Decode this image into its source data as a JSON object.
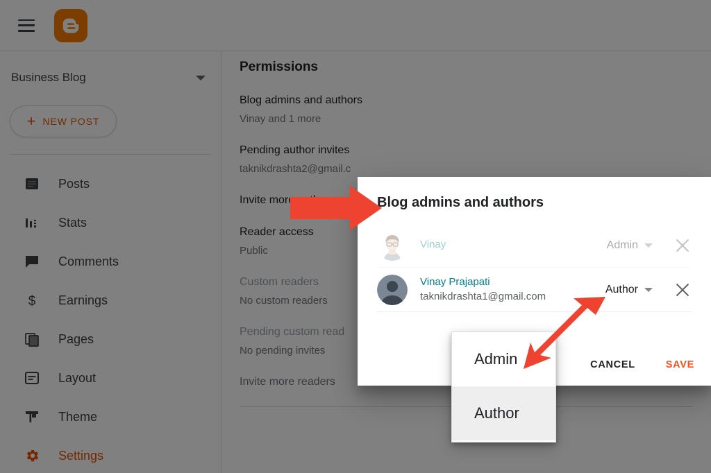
{
  "app": {
    "name": "Blogger",
    "accent_orange": "#e65100",
    "logo_bg": "#f57c00",
    "scrim_color": "#808080",
    "arrow_color": "#ef4331"
  },
  "topbar": {
    "menu_icon": "hamburger-menu-icon",
    "logo_icon": "blogger-logo-icon"
  },
  "sidebar": {
    "blog_name": "Business Blog",
    "blog_picker_icon": "chevron-down-icon",
    "new_post_label": "NEW POST",
    "new_post_icon": "plus-icon",
    "items": [
      {
        "label": "Posts",
        "icon": "posts-icon",
        "active": false
      },
      {
        "label": "Stats",
        "icon": "stats-icon",
        "active": false
      },
      {
        "label": "Comments",
        "icon": "comments-icon",
        "active": false
      },
      {
        "label": "Earnings",
        "icon": "earnings-icon",
        "active": false
      },
      {
        "label": "Pages",
        "icon": "pages-icon",
        "active": false
      },
      {
        "label": "Layout",
        "icon": "layout-icon",
        "active": false
      },
      {
        "label": "Theme",
        "icon": "theme-icon",
        "active": false
      },
      {
        "label": "Settings",
        "icon": "gear-icon",
        "active": true
      }
    ]
  },
  "main": {
    "page_title": "Permissions",
    "settings": [
      {
        "title": "Blog admins and authors",
        "value": "Vinay and 1 more"
      },
      {
        "title": "Pending author invites",
        "value": "taknikdrashta2@gmail.c"
      },
      {
        "title": "Invite more authors",
        "value": ""
      },
      {
        "title": "Reader access",
        "value": "Public"
      },
      {
        "title": "Custom readers",
        "value": "No custom readers"
      },
      {
        "title": "Pending custom read",
        "value": "No pending invites"
      },
      {
        "title": "Invite more readers",
        "value": ""
      }
    ]
  },
  "modal": {
    "title": "Blog admins and authors",
    "people": [
      {
        "name": "Vinay",
        "email": "",
        "role": "Admin",
        "avatar": "avatar-illustrated-man-icon",
        "remove_icon": "close-icon",
        "role_caret_icon": "chevron-down-icon"
      },
      {
        "name": "Vinay Prajapati",
        "email": "taknikdrashta1@gmail.com",
        "role": "Author",
        "avatar": "avatar-default-person-icon",
        "remove_icon": "close-icon",
        "role_caret_icon": "chevron-down-icon"
      }
    ],
    "cancel_label": "CANCEL",
    "save_label": "SAVE"
  },
  "role_dropdown": {
    "options": [
      {
        "label": "Admin",
        "selected": false
      },
      {
        "label": "Author",
        "selected": true
      }
    ]
  },
  "annotations": [
    {
      "name": "arrow-to-dialog-title",
      "direction": "right"
    },
    {
      "name": "arrow-to-admin-option",
      "direction": "down-left"
    }
  ]
}
